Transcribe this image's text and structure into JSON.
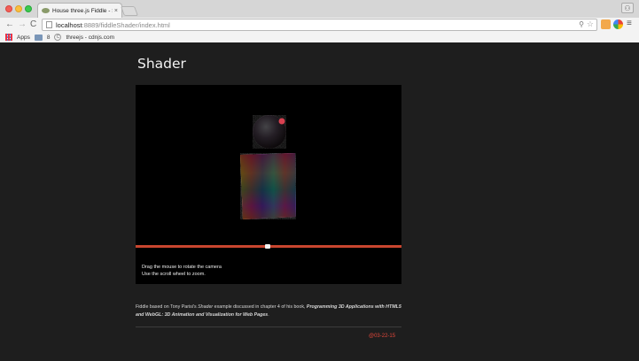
{
  "browser": {
    "tab_title": "House three.js Fiddle - Sh",
    "tab_close": "×",
    "url_host": "localhost",
    "url_rest": ":8889/fiddleShader/index.html",
    "back_glyph": "←",
    "forward_glyph": "→",
    "reload_glyph": "C",
    "zoom_glyph": "⚲",
    "star_glyph": "☆",
    "menu_glyph": "≡",
    "profile_glyph": "⚇",
    "bookmarks": {
      "apps_label": "Apps",
      "folder_label": "8",
      "threejs_label": "threejs - cdnjs.com"
    }
  },
  "page": {
    "title": "Shader",
    "hint_line_1": "Drag the mouse to rotate the camera",
    "hint_line_2": "Use the scroll wheel to zoom.",
    "description": {
      "part1": "Fiddle based on Tony Parisi's ",
      "shader_word": "Shader",
      "part2": " example discussed in chapter 4 of his book, ",
      "book_title": "Programming 3D Applications with HTML5 and WebGL: 3D Animation and Visualization for Web Pages",
      "part3": "."
    },
    "date": "@03-22-15"
  },
  "colors": {
    "page_bg": "#1e1e1e",
    "accent_red": "#c8452f",
    "date_red": "#e0473a"
  },
  "icons": [
    "close-icon",
    "search-icon",
    "star-icon",
    "menu-icon",
    "apps-icon",
    "folder-icon"
  ]
}
